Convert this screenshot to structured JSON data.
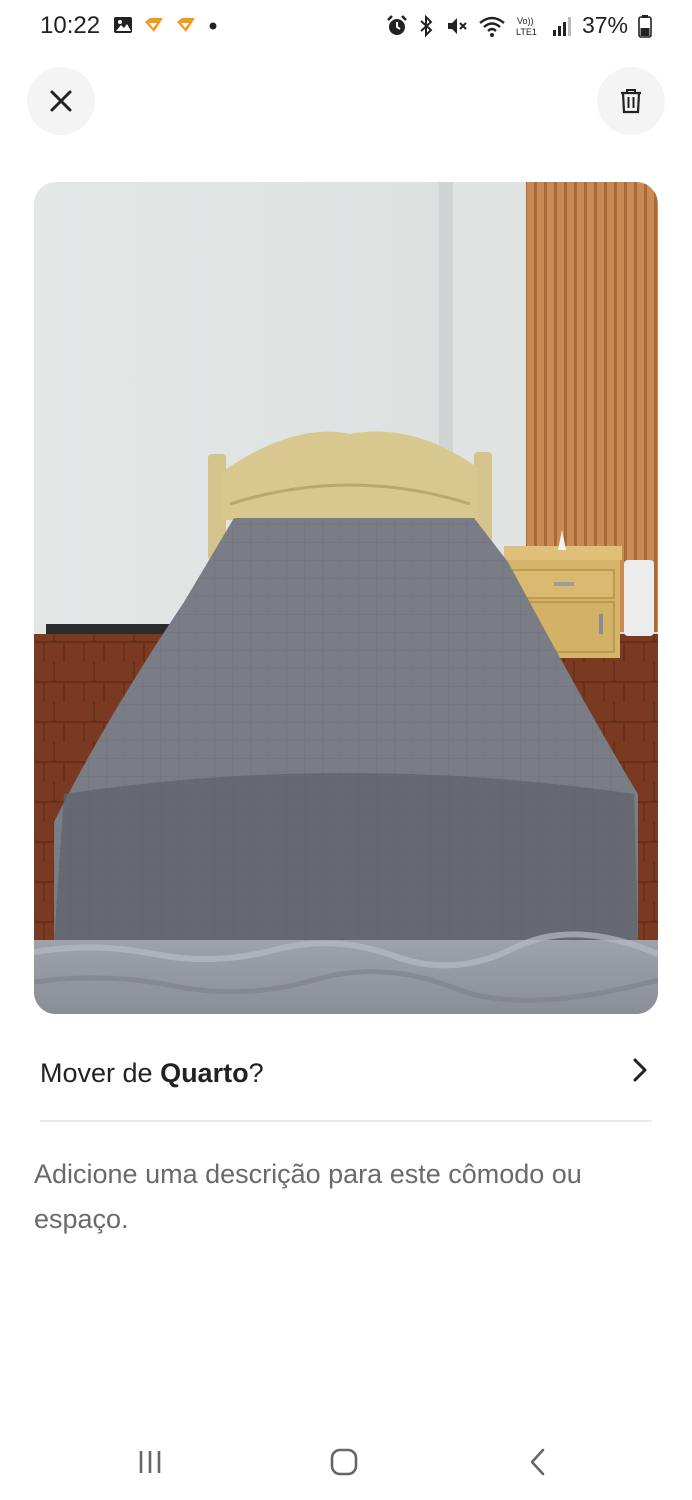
{
  "status_bar": {
    "time": "10:22",
    "battery": "37%",
    "left_icons": [
      "image-icon",
      "app-notification-icon",
      "app-notification-icon",
      "dot-icon"
    ],
    "right_icons": [
      "alarm-icon",
      "bluetooth-icon",
      "mute-icon",
      "wifi-icon",
      "volte-icon",
      "signal-icon",
      "battery-icon"
    ]
  },
  "toolbar": {
    "close_icon": "close-icon",
    "delete_icon": "trash-icon"
  },
  "photo": {
    "subject": "bedroom-photo"
  },
  "move": {
    "prefix": "Mover de ",
    "room": "Quarto",
    "suffix": "?"
  },
  "description": {
    "placeholder": "Adicione uma descrição para este cômodo ou espaço."
  },
  "nav": {
    "icons": [
      "recents-icon",
      "home-icon",
      "back-icon"
    ]
  },
  "colors": {
    "accent_orange": "#f39a1e",
    "text": "#222222",
    "muted": "#6a6a6a",
    "button_bg": "#f4f4f4"
  }
}
